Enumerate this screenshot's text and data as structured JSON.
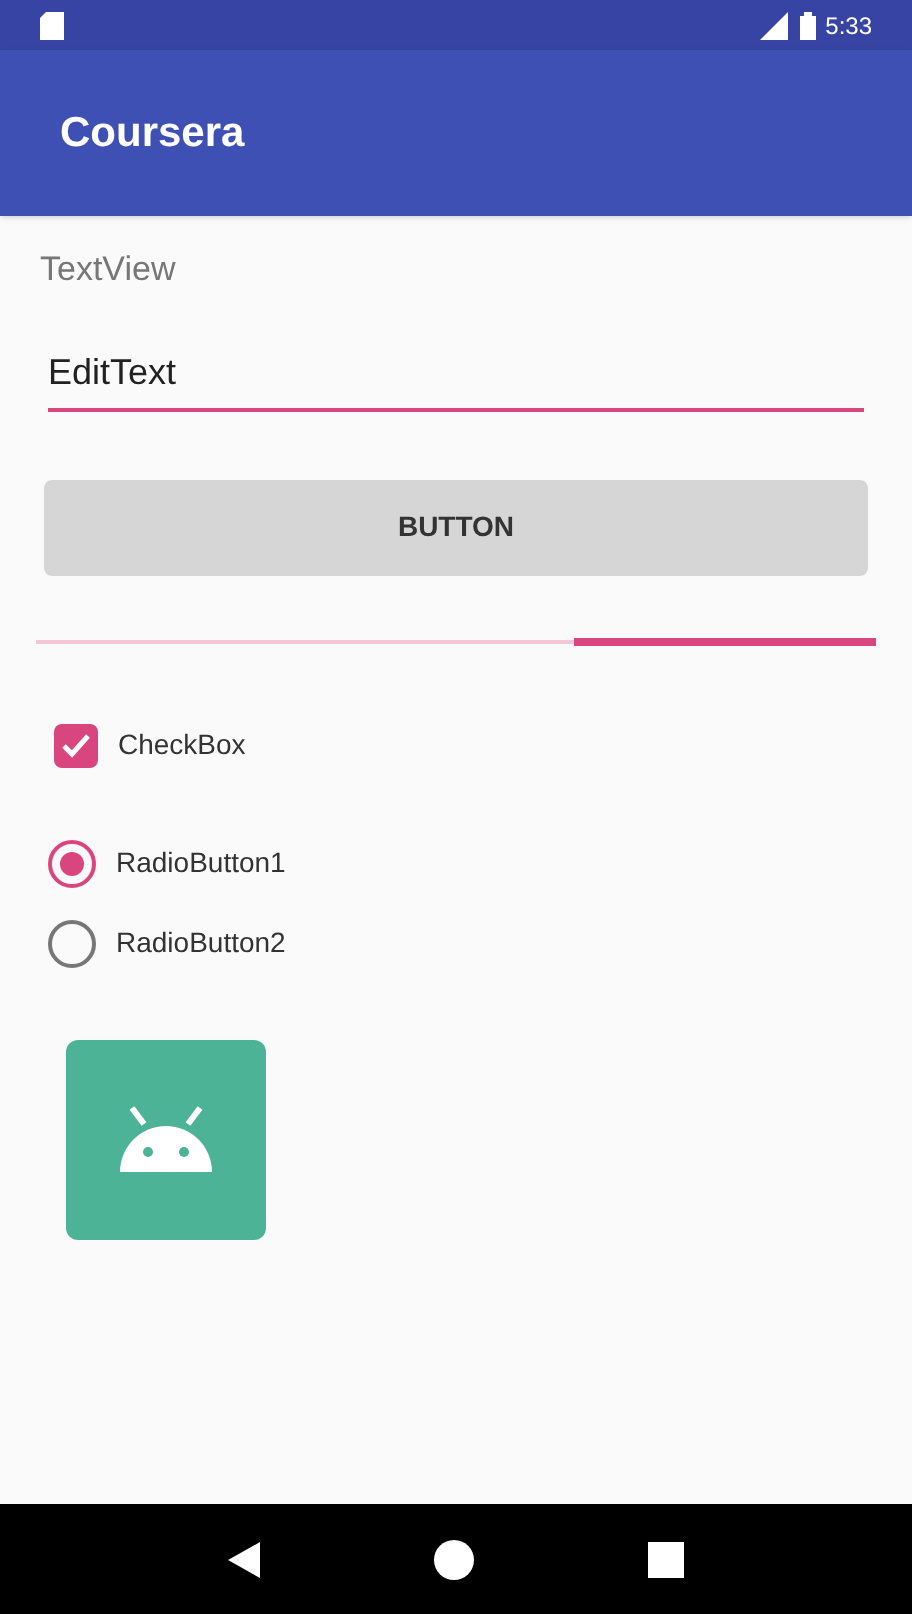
{
  "status_bar": {
    "time": "5:33"
  },
  "app_bar": {
    "title": "Coursera"
  },
  "text_view": "TextView",
  "edit_text": {
    "value": "EditText"
  },
  "button": "BUTTON",
  "progress": {
    "level": 0.36
  },
  "checkbox": {
    "label": "CheckBox",
    "checked": true
  },
  "radios": [
    {
      "label": "RadioButton1",
      "selected": true
    },
    {
      "label": "RadioButton2",
      "selected": false
    }
  ]
}
